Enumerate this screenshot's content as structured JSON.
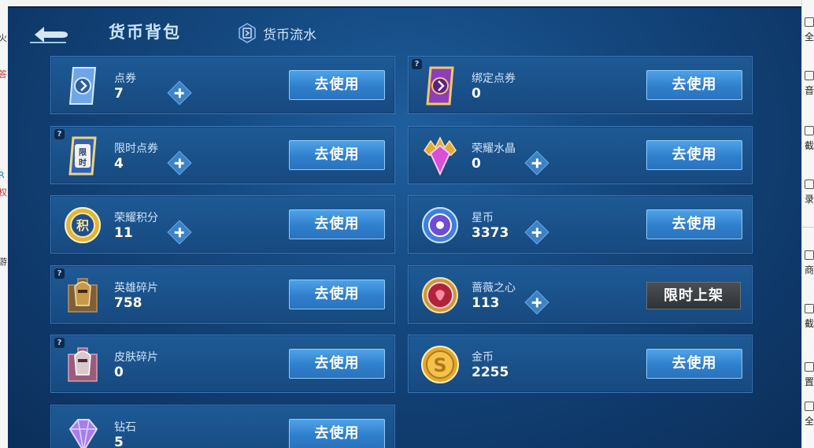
{
  "header": {
    "title": "货币背包",
    "flow_label": "货币流水"
  },
  "help_mark": "?",
  "currencies_left": [
    {
      "name": "点券",
      "value": "7",
      "button": "去使用",
      "has_plus": true,
      "has_help": false,
      "icon": "ticket-icon"
    },
    {
      "name": "限时点券",
      "value": "4",
      "button": "去使用",
      "has_plus": true,
      "has_help": true,
      "icon": "limited-ticket-icon"
    },
    {
      "name": "荣耀积分",
      "value": "11",
      "button": "去使用",
      "has_plus": true,
      "has_help": false,
      "icon": "honor-points-icon"
    },
    {
      "name": "英雄碎片",
      "value": "758",
      "button": "去使用",
      "has_plus": false,
      "has_help": true,
      "icon": "hero-fragment-icon"
    },
    {
      "name": "皮肤碎片",
      "value": "0",
      "button": "去使用",
      "has_plus": false,
      "has_help": true,
      "icon": "skin-fragment-icon"
    },
    {
      "name": "钻石",
      "value": "5",
      "button": "去使用",
      "has_plus": false,
      "has_help": false,
      "icon": "diamond-icon"
    }
  ],
  "currencies_right": [
    {
      "name": "绑定点券",
      "value": "0",
      "button": "去使用",
      "has_plus": false,
      "has_help": true,
      "icon": "bound-ticket-icon"
    },
    {
      "name": "荣耀水晶",
      "value": "0",
      "button": "去使用",
      "has_plus": true,
      "has_help": false,
      "icon": "honor-crystal-icon"
    },
    {
      "name": "星币",
      "value": "3373",
      "button": "去使用",
      "has_plus": true,
      "has_help": false,
      "icon": "star-coin-icon"
    },
    {
      "name": "蔷薇之心",
      "value": "113",
      "button": "限时上架",
      "has_plus": true,
      "has_help": false,
      "icon": "rose-heart-icon"
    },
    {
      "name": "金币",
      "value": "2255",
      "button": "去使用",
      "has_plus": false,
      "has_help": false,
      "icon": "gold-coin-icon"
    }
  ],
  "right_panel": {
    "items": [
      "全",
      "音",
      "截",
      "录",
      "商",
      "截",
      "置",
      "全"
    ]
  },
  "colors": {
    "accent_blue": "#2f7fcd",
    "card_bg": "#1e5a96",
    "background": "#154a82"
  }
}
